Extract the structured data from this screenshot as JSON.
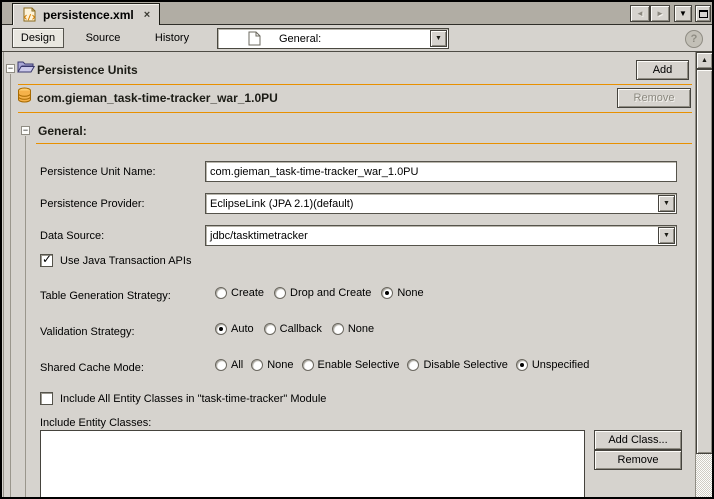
{
  "window": {
    "tab_title": "persistence.xml"
  },
  "icons": {
    "close": "×",
    "back": "◄",
    "forward": "►",
    "dropdown": "▼",
    "combo_arrow": "▼",
    "help": "?",
    "check": "✓",
    "collapse": "−",
    "scroll_up": "▲"
  },
  "toolbar": {
    "design": "Design",
    "source": "Source",
    "history": "History",
    "view_selector": "General:"
  },
  "persistence_units": {
    "title": "Persistence Units",
    "add_button": "Add",
    "unit": {
      "name": "com.gieman_task-time-tracker_war_1.0PU",
      "remove_button": "Remove"
    }
  },
  "general": {
    "title": "General:",
    "unit_name": {
      "label": "Persistence Unit Name:",
      "value": "com.gieman_task-time-tracker_war_1.0PU"
    },
    "provider": {
      "label": "Persistence Provider:",
      "value": "EclipseLink (JPA 2.1)(default)"
    },
    "data_source": {
      "label": "Data Source:",
      "value": "jdbc/tasktimetracker"
    },
    "use_jta": {
      "label": "Use Java Transaction APIs",
      "checked": true
    },
    "table_generation": {
      "label": "Table Generation Strategy:",
      "options": [
        "Create",
        "Drop and Create",
        "None"
      ],
      "selected": "None"
    },
    "validation": {
      "label": "Validation Strategy:",
      "options": [
        "Auto",
        "Callback",
        "None"
      ],
      "selected": "Auto"
    },
    "shared_cache": {
      "label": "Shared Cache Mode:",
      "options": [
        "All",
        "None",
        "Enable Selective",
        "Disable Selective",
        "Unspecified"
      ],
      "selected": "Unspecified"
    },
    "include_all_classes": {
      "label": "Include All Entity Classes in \"task-time-tracker\" Module",
      "checked": false
    },
    "include_entity_classes": {
      "label": "Include Entity Classes:",
      "items": [],
      "add_class_button": "Add Class...",
      "remove_button": "Remove"
    }
  },
  "colors": {
    "background": "#d6d3ce",
    "accent_rule": "#e89000",
    "tab_strip": "#b1ada4"
  }
}
